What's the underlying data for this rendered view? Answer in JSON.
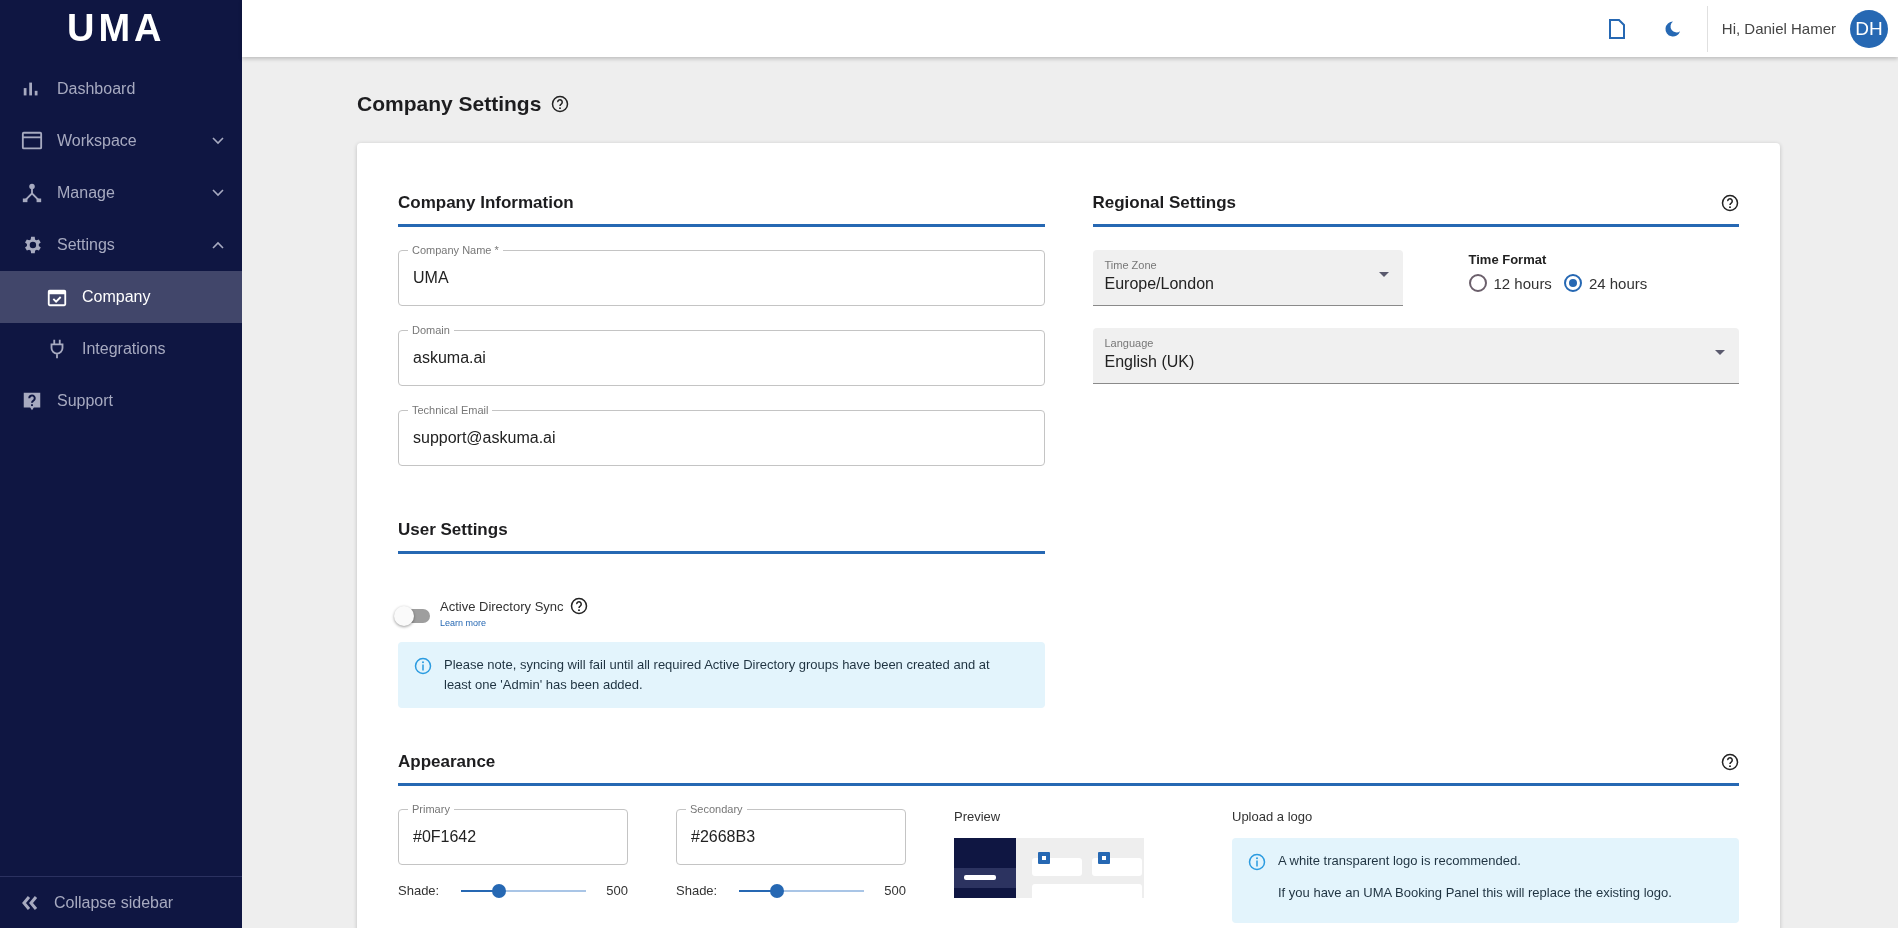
{
  "sidebar": {
    "logo": "UMA",
    "items": [
      {
        "label": "Dashboard",
        "selected": false
      },
      {
        "label": "Workspace",
        "selected": false,
        "expanded": false
      },
      {
        "label": "Manage",
        "selected": false,
        "expanded": false
      },
      {
        "label": "Settings",
        "selected": false,
        "expanded": true,
        "children": [
          {
            "label": "Company",
            "selected": true
          },
          {
            "label": "Integrations",
            "selected": false
          }
        ]
      },
      {
        "label": "Support",
        "selected": false
      }
    ],
    "collapse": "Collapse sidebar"
  },
  "topbar": {
    "greeting": "Hi, Daniel Hamer",
    "avatar": "DH"
  },
  "page": {
    "title": "Company Settings"
  },
  "company_information": {
    "title": "Company Information",
    "fields": [
      {
        "label": "Company Name *",
        "value": "UMA"
      },
      {
        "label": "Domain",
        "value": "askuma.ai"
      },
      {
        "label": "Technical Email",
        "value": "support@askuma.ai"
      }
    ]
  },
  "user_settings": {
    "title": "User Settings",
    "toggle": {
      "label": "Active Directory Sync",
      "on": false,
      "link": "Learn more"
    },
    "notice": "Please note, syncing will fail until all required Active Directory groups have been created and at least one 'Admin' has been added."
  },
  "regional_settings": {
    "title": "Regional Settings",
    "time_zone": {
      "label": "Time Zone",
      "value": "Europe/London"
    },
    "time_format": {
      "label": "Time Format",
      "options": [
        {
          "label": "12 hours",
          "selected": false
        },
        {
          "label": "24 hours",
          "selected": true
        }
      ]
    },
    "language": {
      "label": "Language",
      "value": "English (UK)"
    }
  },
  "appearance": {
    "title": "Appearance",
    "colors": [
      {
        "label": "Primary",
        "value": "#0F1642",
        "shade_label": "Shade:",
        "level": 0.3,
        "reading": "500"
      },
      {
        "label": "Secondary",
        "value": "#2668B3",
        "shade_label": "Shade:",
        "level": 0.3,
        "reading": "500"
      }
    ],
    "preview_label": "Preview",
    "upload_label": "Upload a logo",
    "notice": [
      "A white transparent logo is recommended.",
      "If you have an UMA Booking Panel this will replace the existing logo."
    ]
  }
}
